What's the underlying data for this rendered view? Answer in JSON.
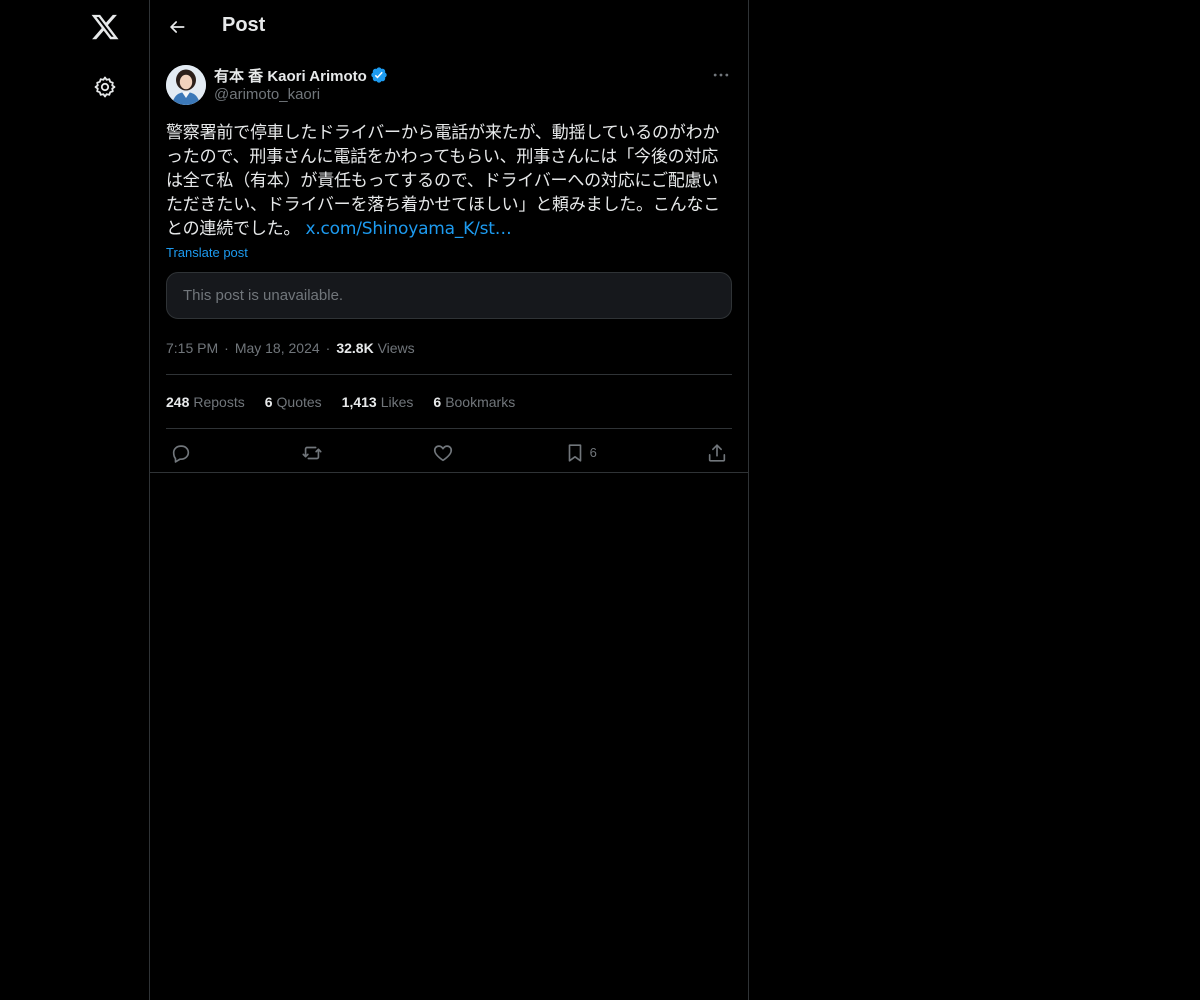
{
  "header": {
    "title": "Post"
  },
  "nav": {
    "logo_icon": "x-logo-icon",
    "settings_icon": "gear-icon"
  },
  "post": {
    "author": {
      "display_name": "有本 香 Kaori Arimoto",
      "handle": "@arimoto_kaori",
      "verified": true,
      "verified_color": "#1d9bf0"
    },
    "text": "警察署前で停車したドライバーから電話が来たが、動揺しているのがわかったので、刑事さんに電話をかわってもらい、刑事さんには「今後の対応は全て私（有本）が責任もってするので、ドライバーへの対応にご配慮いただきたい、ドライバーを落ち着かせてほしい」と頼みました。こんなことの連続でした。",
    "link_text": "x.com/Shinoyama_K/st…",
    "translate_label": "Translate post",
    "quote_unavailable": "This post is unavailable.",
    "time": "7:15 PM",
    "date": "May 18, 2024",
    "views_count": "32.8K",
    "views_label": "Views"
  },
  "stats": {
    "reposts_count": "248",
    "reposts_label": "Reposts",
    "quotes_count": "6",
    "quotes_label": "Quotes",
    "likes_count": "1,413",
    "likes_label": "Likes",
    "bookmarks_count": "6",
    "bookmarks_label": "Bookmarks"
  },
  "actions": {
    "bookmark_count": "6"
  },
  "colors": {
    "background": "#000000",
    "border": "#2f3336",
    "text_primary": "#e7e9ea",
    "text_secondary": "#71767b",
    "accent": "#1d9bf0"
  }
}
